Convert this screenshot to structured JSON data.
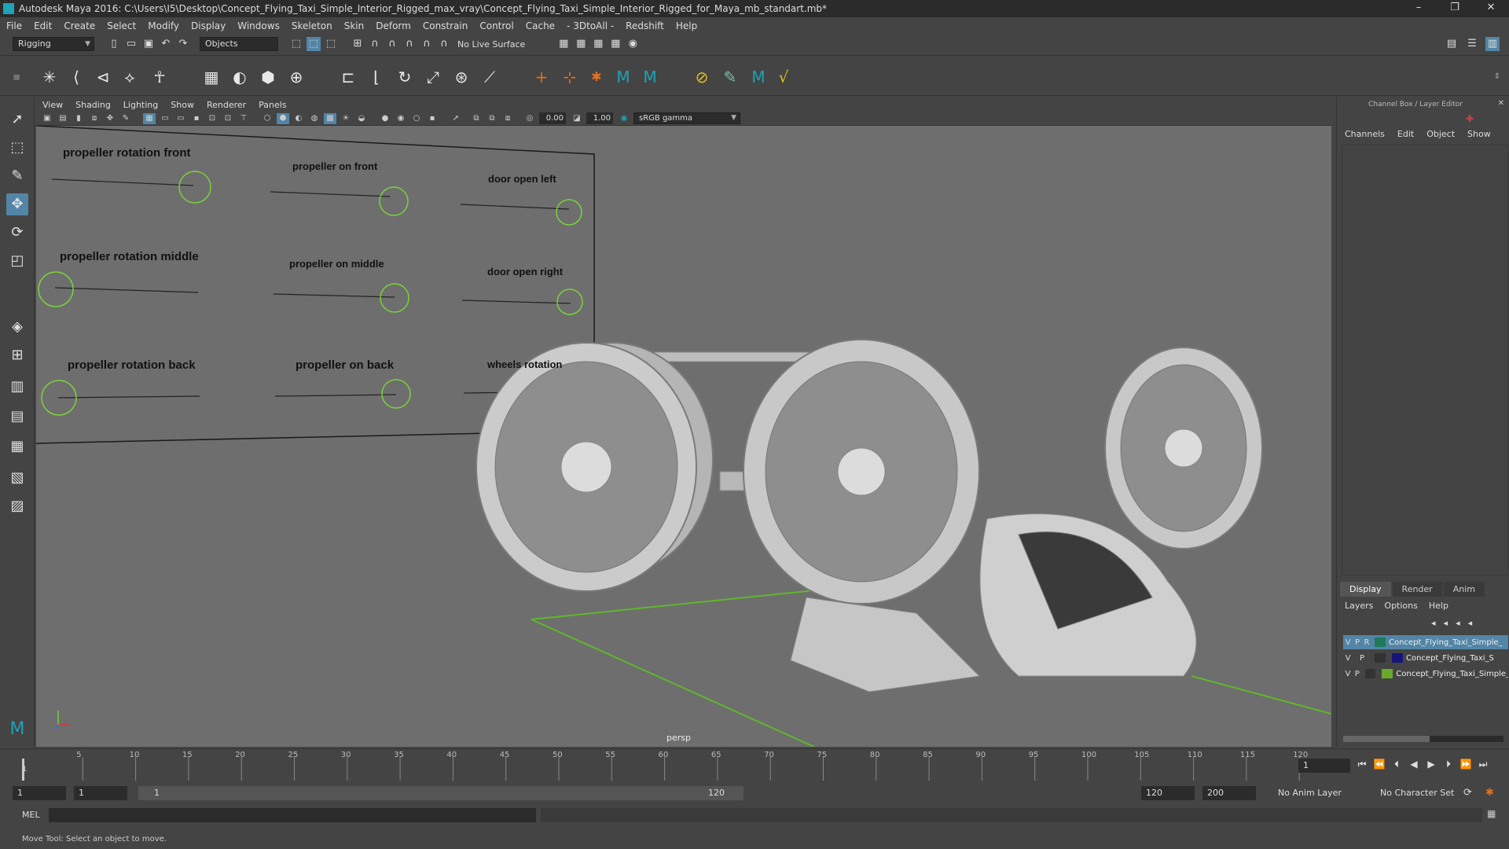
{
  "window": {
    "title": "Autodesk Maya 2016: C:\\Users\\I5\\Desktop\\Concept_Flying_Taxi_Simple_Interior_Rigged_max_vray\\Concept_Flying_Taxi_Simple_Interior_Rigged_for_Maya_mb_standart.mb*",
    "minimize": "–",
    "maximize": "❐",
    "close": "✕"
  },
  "menubar": [
    "File",
    "Edit",
    "Create",
    "Select",
    "Modify",
    "Display",
    "Windows",
    "Skeleton",
    "Skin",
    "Deform",
    "Constrain",
    "Control",
    "Cache",
    "- 3DtoAll -",
    "Redshift",
    "Help"
  ],
  "statusline": {
    "mode": "Rigging",
    "select_mode": "Objects",
    "live_surface": "No Live Surface"
  },
  "panel": {
    "menus": [
      "View",
      "Shading",
      "Lighting",
      "Show",
      "Renderer",
      "Panels"
    ],
    "exposure": "0.00",
    "gamma": "1.00",
    "color_space": "sRGB gamma",
    "camera_label": "persp"
  },
  "controls": {
    "labels": [
      "propeller rotation front",
      "propeller on front",
      "door open left",
      "propeller rotation middle",
      "propeller on middle",
      "door open right",
      "propeller rotation back",
      "propeller on back",
      "wheels rotation"
    ]
  },
  "channel_box": {
    "title": "Channel Box / Layer Editor",
    "menus": [
      "Channels",
      "Edit",
      "Object",
      "Show"
    ]
  },
  "layer_editor": {
    "tabs": [
      "Display",
      "Render",
      "Anim"
    ],
    "menus": [
      "Layers",
      "Options",
      "Help"
    ],
    "layers": [
      {
        "v": "V",
        "p": "P",
        "r": "R",
        "color": "#1e7a5a",
        "name": "Concept_Flying_Taxi_Simple_"
      },
      {
        "v": "V",
        "p": "P",
        "r": "",
        "color": "#15157a",
        "name": "Concept_Flying_Taxi_S"
      },
      {
        "v": "V",
        "p": "P",
        "r": "",
        "color": "#6aaa2a",
        "name": "Concept_Flying_Taxi_Simple_"
      }
    ]
  },
  "timeline": {
    "ticks": [
      "5",
      "10",
      "15",
      "20",
      "25",
      "30",
      "35",
      "40",
      "45",
      "50",
      "55",
      "60",
      "65",
      "70",
      "75",
      "80",
      "85",
      "90",
      "95",
      "100",
      "105",
      "110",
      "115",
      "120"
    ],
    "start_tick": "1",
    "current_frame": "1"
  },
  "range": {
    "start": "1",
    "playback_start": "1",
    "slider_start": "1",
    "slider_end": "120",
    "playback_end": "120",
    "end": "200",
    "anim_layer": "No Anim Layer",
    "character_set": "No Character Set"
  },
  "command": {
    "language": "MEL"
  },
  "help": {
    "text": "Move Tool: Select an object to move."
  }
}
